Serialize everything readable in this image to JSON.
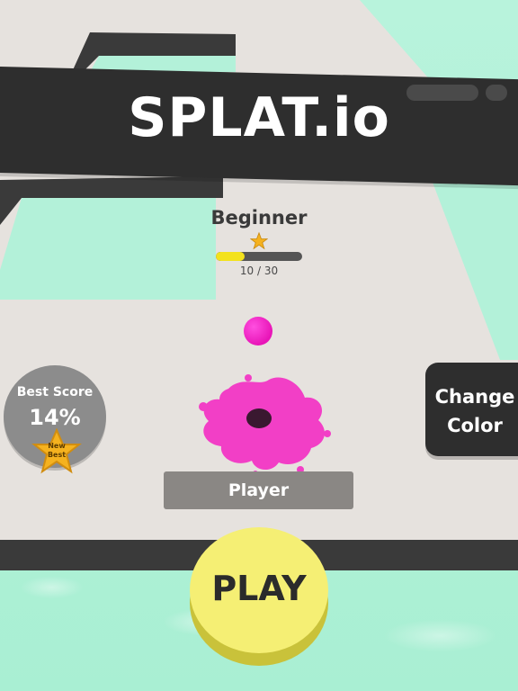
{
  "app": {
    "title": "SPLAT.io"
  },
  "level": {
    "rank": "Beginner",
    "progress_text": "10 / 30",
    "progress_fraction": 0.33
  },
  "best_score": {
    "label": "Best Score",
    "value": "14%",
    "badge_line1": "New",
    "badge_line2": "Best"
  },
  "buttons": {
    "change_color_line1": "Change",
    "change_color_line2": "Color",
    "play": "PLAY"
  },
  "player": {
    "name": "Player"
  },
  "colors": {
    "paint": "#f23fc6",
    "ball": "#e815b7",
    "dark_panel": "#2e2e2e",
    "play_button": "#f5ef74",
    "progress_fill": "#f3e21c",
    "star": "#f5b21f"
  },
  "icons": {
    "rank_star": "star-icon",
    "new_best_badge": "star-badge-icon"
  }
}
